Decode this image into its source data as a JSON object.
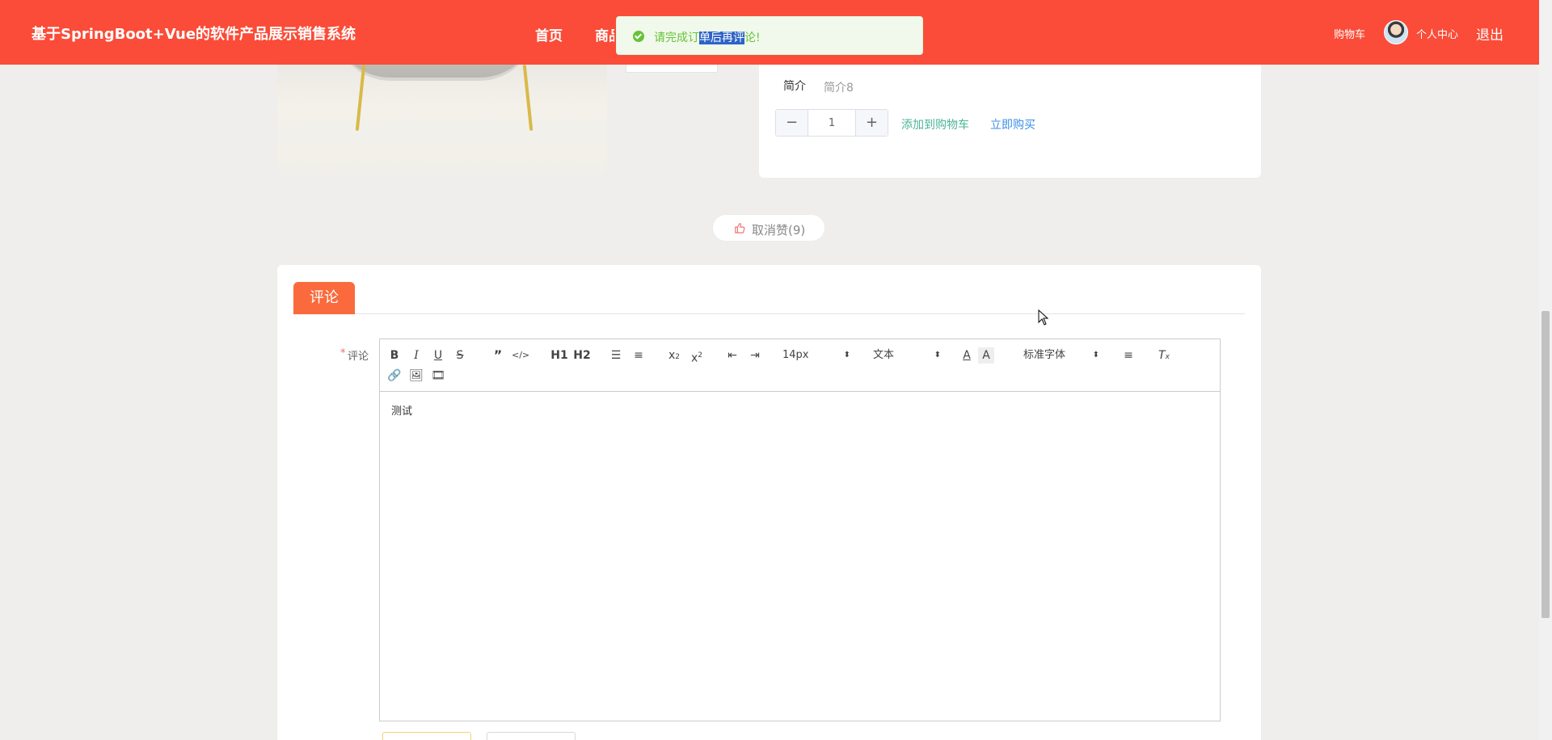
{
  "header": {
    "site_title": "基于SpringBoot+Vue的软件产品展示销售系统",
    "nav_home": "首页",
    "nav_goods": "商品",
    "nav_cart": "购物车",
    "nav_center": "个人中心",
    "nav_logout": "退出"
  },
  "toast": {
    "text_before": "请完成订",
    "text_selected": "单后再评",
    "text_after": "论!"
  },
  "product": {
    "intro_label": "简介",
    "intro_value": "简介8",
    "quantity": "1",
    "minus_symbol": "−",
    "plus_symbol": "+",
    "add_cart_label": "添加到购物车",
    "buy_now_label": "立即购买"
  },
  "like": {
    "label": "取消赞(9)"
  },
  "comment": {
    "tab_label": "评论",
    "required_mark": "*",
    "field_label": "评论",
    "editor_content": "测试",
    "toolbar": {
      "font_size": "14px",
      "heading": "文本",
      "font_family": "标准字体",
      "h1": "H1",
      "h2": "H2"
    }
  },
  "colors": {
    "header": "#fa4c38",
    "tab": "#fa6a3c",
    "success": "#67c23a",
    "add_cart": "#4bb497",
    "buy_now": "#3a8ee6"
  }
}
